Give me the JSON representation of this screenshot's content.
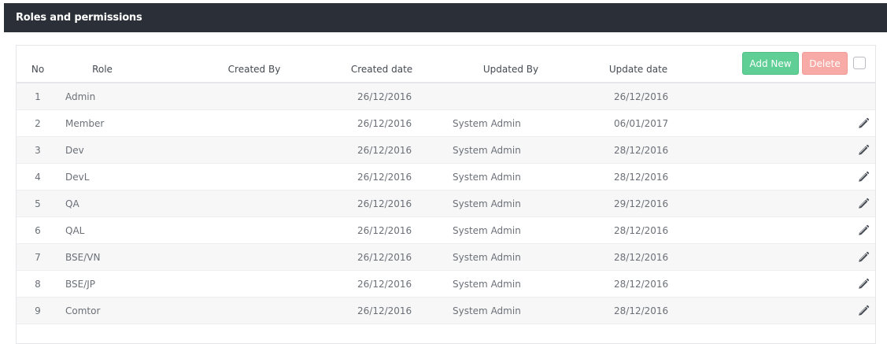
{
  "header": {
    "title": "Roles and permissions"
  },
  "table": {
    "columns": [
      "No",
      "Role",
      "Created By",
      "Created date",
      "Updated By",
      "Update date"
    ],
    "rows": [
      {
        "no": "1",
        "role": "Admin",
        "created_by": "",
        "created_date": "26/12/2016",
        "updated_by": "",
        "update_date": "26/12/2016",
        "editable": false
      },
      {
        "no": "2",
        "role": "Member",
        "created_by": "",
        "created_date": "26/12/2016",
        "updated_by": "System Admin",
        "update_date": "06/01/2017",
        "editable": true
      },
      {
        "no": "3",
        "role": "Dev",
        "created_by": "",
        "created_date": "26/12/2016",
        "updated_by": "System Admin",
        "update_date": "28/12/2016",
        "editable": true
      },
      {
        "no": "4",
        "role": "DevL",
        "created_by": "",
        "created_date": "26/12/2016",
        "updated_by": "System Admin",
        "update_date": "28/12/2016",
        "editable": true
      },
      {
        "no": "5",
        "role": "QA",
        "created_by": "",
        "created_date": "26/12/2016",
        "updated_by": "System Admin",
        "update_date": "29/12/2016",
        "editable": true
      },
      {
        "no": "6",
        "role": "QAL",
        "created_by": "",
        "created_date": "26/12/2016",
        "updated_by": "System Admin",
        "update_date": "28/12/2016",
        "editable": true
      },
      {
        "no": "7",
        "role": "BSE/VN",
        "created_by": "",
        "created_date": "26/12/2016",
        "updated_by": "System Admin",
        "update_date": "28/12/2016",
        "editable": true
      },
      {
        "no": "8",
        "role": "BSE/JP",
        "created_by": "",
        "created_date": "26/12/2016",
        "updated_by": "System Admin",
        "update_date": "28/12/2016",
        "editable": true
      },
      {
        "no": "9",
        "role": "Comtor",
        "created_by": "",
        "created_date": "26/12/2016",
        "updated_by": "System Admin",
        "update_date": "28/12/2016",
        "editable": true
      }
    ]
  },
  "actions": {
    "add_label": "Add New",
    "delete_label": "Delete"
  },
  "icons": {
    "edit": "pencil-icon",
    "select_all": "checkbox"
  },
  "colors": {
    "header_bg": "#2b3038",
    "add_button": "#5fcf95",
    "delete_button": "#f7aaa6",
    "row_stripe": "#f7f7f7"
  }
}
